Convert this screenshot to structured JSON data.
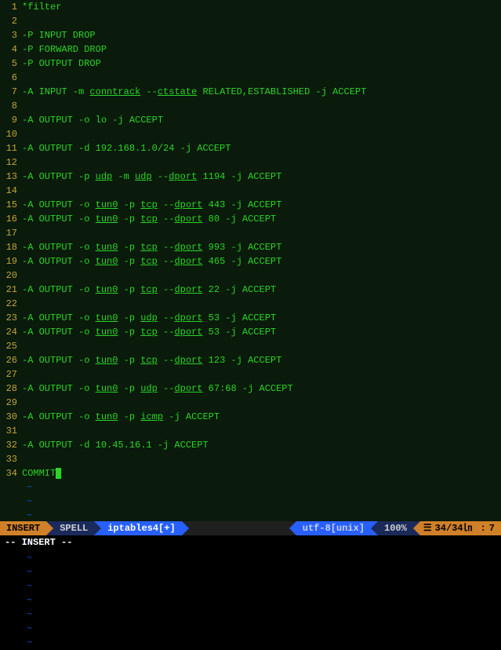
{
  "editor": {
    "filetype": "iptables",
    "lines": [
      {
        "n": 1,
        "segs": [
          {
            "t": "*filter"
          }
        ]
      },
      {
        "n": 2,
        "segs": []
      },
      {
        "n": 3,
        "segs": [
          {
            "t": "-P INPUT DROP"
          }
        ]
      },
      {
        "n": 4,
        "segs": [
          {
            "t": "-P FORWARD DROP"
          }
        ]
      },
      {
        "n": 5,
        "segs": [
          {
            "t": "-P OUTPUT DROP"
          }
        ]
      },
      {
        "n": 6,
        "segs": []
      },
      {
        "n": 7,
        "segs": [
          {
            "t": "-A INPUT -m "
          },
          {
            "t": "conntrack",
            "u": 1
          },
          {
            "t": " --"
          },
          {
            "t": "ctstate",
            "u": 1
          },
          {
            "t": " RELATED,ESTABLISHED -j ACCEPT"
          }
        ]
      },
      {
        "n": 8,
        "segs": []
      },
      {
        "n": 9,
        "segs": [
          {
            "t": "-A OUTPUT -o lo -j ACCEPT"
          }
        ]
      },
      {
        "n": 10,
        "segs": []
      },
      {
        "n": 11,
        "segs": [
          {
            "t": "-A OUTPUT -d 192.168.1.0/24 -j ACCEPT"
          }
        ]
      },
      {
        "n": 12,
        "segs": []
      },
      {
        "n": 13,
        "segs": [
          {
            "t": "-A OUTPUT -p "
          },
          {
            "t": "udp",
            "u": 1
          },
          {
            "t": " -m "
          },
          {
            "t": "udp",
            "u": 1
          },
          {
            "t": " --"
          },
          {
            "t": "dport",
            "u": 1
          },
          {
            "t": " 1194 -j ACCEPT"
          }
        ]
      },
      {
        "n": 14,
        "segs": []
      },
      {
        "n": 15,
        "segs": [
          {
            "t": "-A OUTPUT -o "
          },
          {
            "t": "tun0",
            "u": 1
          },
          {
            "t": " -p "
          },
          {
            "t": "tcp",
            "u": 1
          },
          {
            "t": " --"
          },
          {
            "t": "dport",
            "u": 1
          },
          {
            "t": " 443 -j ACCEPT"
          }
        ]
      },
      {
        "n": 16,
        "segs": [
          {
            "t": "-A OUTPUT -o "
          },
          {
            "t": "tun0",
            "u": 1
          },
          {
            "t": " -p "
          },
          {
            "t": "tcp",
            "u": 1
          },
          {
            "t": " --"
          },
          {
            "t": "dport",
            "u": 1
          },
          {
            "t": " 80 -j ACCEPT"
          }
        ]
      },
      {
        "n": 17,
        "segs": []
      },
      {
        "n": 18,
        "segs": [
          {
            "t": "-A OUTPUT -o "
          },
          {
            "t": "tun0",
            "u": 1
          },
          {
            "t": " -p "
          },
          {
            "t": "tcp",
            "u": 1
          },
          {
            "t": " --"
          },
          {
            "t": "dport",
            "u": 1
          },
          {
            "t": " 993 -j ACCEPT"
          }
        ]
      },
      {
        "n": 19,
        "segs": [
          {
            "t": "-A OUTPUT -o "
          },
          {
            "t": "tun0",
            "u": 1
          },
          {
            "t": " -p "
          },
          {
            "t": "tcp",
            "u": 1
          },
          {
            "t": " --"
          },
          {
            "t": "dport",
            "u": 1
          },
          {
            "t": " 465 -j ACCEPT"
          }
        ]
      },
      {
        "n": 20,
        "segs": []
      },
      {
        "n": 21,
        "segs": [
          {
            "t": "-A OUTPUT -o "
          },
          {
            "t": "tun0",
            "u": 1
          },
          {
            "t": " -p "
          },
          {
            "t": "tcp",
            "u": 1
          },
          {
            "t": " --"
          },
          {
            "t": "dport",
            "u": 1
          },
          {
            "t": " 22 -j ACCEPT"
          }
        ]
      },
      {
        "n": 22,
        "segs": []
      },
      {
        "n": 23,
        "segs": [
          {
            "t": "-A OUTPUT -o "
          },
          {
            "t": "tun0",
            "u": 1
          },
          {
            "t": " -p "
          },
          {
            "t": "udp",
            "u": 1
          },
          {
            "t": " --"
          },
          {
            "t": "dport",
            "u": 1
          },
          {
            "t": " 53 -j ACCEPT"
          }
        ]
      },
      {
        "n": 24,
        "segs": [
          {
            "t": "-A OUTPUT -o "
          },
          {
            "t": "tun0",
            "u": 1
          },
          {
            "t": " -p "
          },
          {
            "t": "tcp",
            "u": 1
          },
          {
            "t": " --"
          },
          {
            "t": "dport",
            "u": 1
          },
          {
            "t": " 53 -j ACCEPT"
          }
        ]
      },
      {
        "n": 25,
        "segs": []
      },
      {
        "n": 26,
        "segs": [
          {
            "t": "-A OUTPUT -o "
          },
          {
            "t": "tun0",
            "u": 1
          },
          {
            "t": " -p "
          },
          {
            "t": "tcp",
            "u": 1
          },
          {
            "t": " --"
          },
          {
            "t": "dport",
            "u": 1
          },
          {
            "t": " 123 -j ACCEPT"
          }
        ]
      },
      {
        "n": 27,
        "segs": []
      },
      {
        "n": 28,
        "segs": [
          {
            "t": "-A OUTPUT -o "
          },
          {
            "t": "tun0",
            "u": 1
          },
          {
            "t": " -p "
          },
          {
            "t": "udp",
            "u": 1
          },
          {
            "t": " --"
          },
          {
            "t": "dport",
            "u": 1
          },
          {
            "t": " 67:68 -j ACCEPT"
          }
        ]
      },
      {
        "n": 29,
        "segs": []
      },
      {
        "n": 30,
        "segs": [
          {
            "t": "-A OUTPUT -o "
          },
          {
            "t": "tun0",
            "u": 1
          },
          {
            "t": " -p "
          },
          {
            "t": "icmp",
            "u": 1
          },
          {
            "t": " -j ACCEPT"
          }
        ]
      },
      {
        "n": 31,
        "segs": []
      },
      {
        "n": 32,
        "segs": [
          {
            "t": "-A OUTPUT -d 10.45.16.1 -j ACCEPT"
          }
        ]
      },
      {
        "n": 33,
        "segs": []
      },
      {
        "n": 34,
        "segs": [
          {
            "t": "COMMIT"
          }
        ],
        "cursor": true
      }
    ],
    "tildes": 12
  },
  "status": {
    "mode": "INSERT",
    "spell": "SPELL",
    "filename": "iptables4[+]",
    "encoding": "utf-8[unix]",
    "percent": "100%",
    "pos_indicator": "☰",
    "lineinfo": "34/34㏑",
    "colsep": ":",
    "col": "7"
  },
  "command": {
    "text": "-- INSERT --"
  },
  "colors": {
    "bg_editor": "#0a1a0b",
    "fg_text": "#2bd525",
    "fg_gutter": "#bfa63a",
    "tilde": "#0050c8",
    "mode_bg": "#d08028",
    "navy": "#1b2a5a",
    "blue": "#2860ff"
  }
}
